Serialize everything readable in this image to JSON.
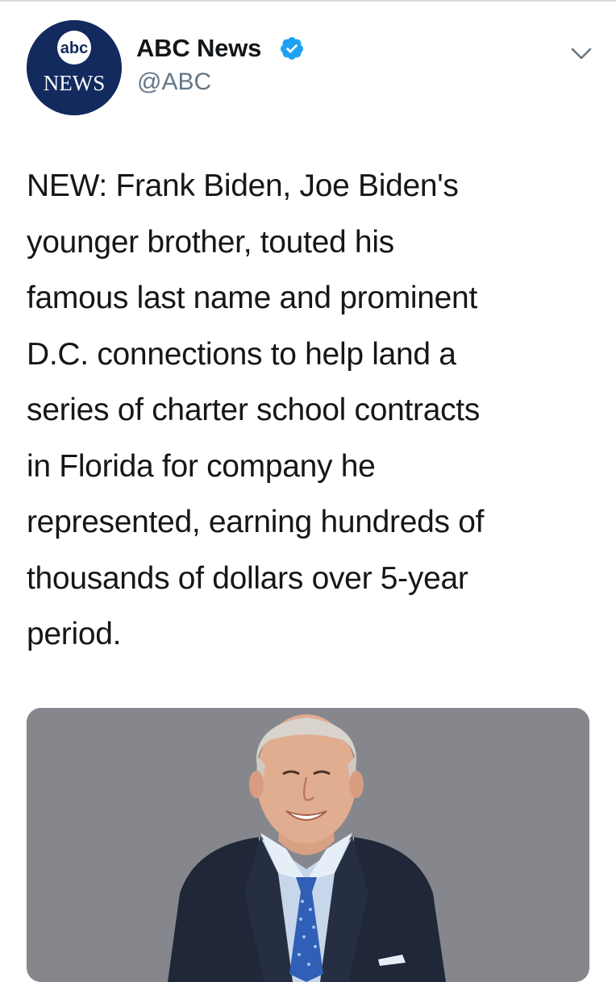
{
  "account": {
    "display_name": "ABC News",
    "handle": "@ABC",
    "avatar_logo_top": "abc",
    "avatar_logo_bottom": "NEWS",
    "verified_icon": "verified-badge-icon",
    "verified_color": "#1da1f2",
    "avatar_color": "#132a5e"
  },
  "menu": {
    "icon": "chevron-down-icon"
  },
  "tweet": {
    "lines": [
      "NEW: Frank Biden, Joe Biden's",
      "younger brother, touted his",
      "famous last name and prominent",
      "D.C. connections to help land a",
      "series of charter school contracts",
      "in Florida for company he",
      "represented, earning hundreds of",
      "thousands of dollars over 5-year",
      "period."
    ]
  },
  "media": {
    "background_color": "#85878c"
  }
}
